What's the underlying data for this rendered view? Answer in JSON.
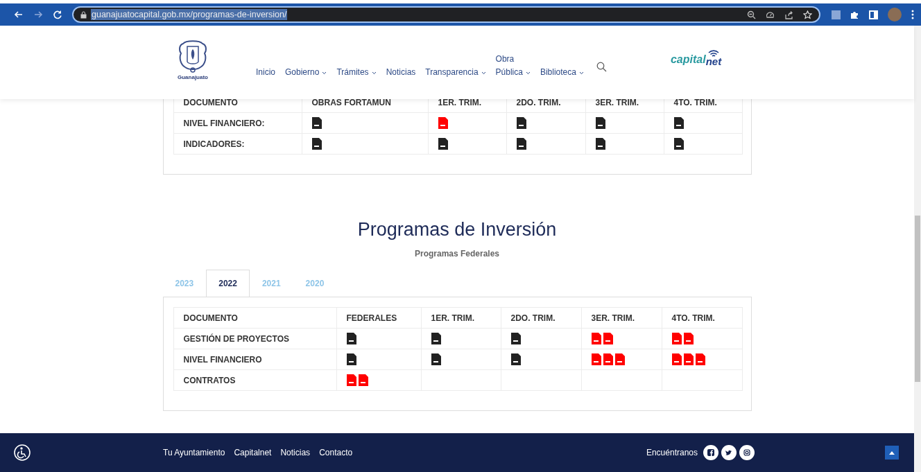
{
  "browser": {
    "url": "guanajuatocapital.gob.mx/programas-de-inversion/"
  },
  "header": {
    "logo_text": "Guanajuato",
    "nav": [
      {
        "label": "Inicio",
        "dropdown": false
      },
      {
        "label": "Gobierno",
        "dropdown": true
      },
      {
        "label": "Trámites",
        "dropdown": true
      },
      {
        "label": "Noticias",
        "dropdown": false
      },
      {
        "label": "Transparencia",
        "dropdown": true
      },
      {
        "label": "Obra Pública",
        "dropdown": true
      },
      {
        "label": "Biblioteca",
        "dropdown": true
      }
    ],
    "brand": {
      "part_1": "capital",
      "part_2": "net"
    }
  },
  "table_1": {
    "columns": [
      "DOCUMENTO",
      "OBRAS FORTAMUN",
      "1ER. TRIM.",
      "2DO. TRIM.",
      "3ER. TRIM.",
      "4TO. TRIM."
    ],
    "rows": [
      {
        "cells": [
          "NIVEL FINANCIERO:",
          [
            {
              "color": "#222222"
            }
          ],
          [
            {
              "color": "#ff0000"
            }
          ],
          [
            {
              "color": "#222222"
            }
          ],
          [
            {
              "color": "#222222"
            }
          ],
          [
            {
              "color": "#222222"
            }
          ]
        ]
      },
      {
        "cells": [
          "INDICADORES:",
          [
            {
              "color": "#222222"
            }
          ],
          [
            {
              "color": "#222222"
            }
          ],
          [
            {
              "color": "#222222"
            }
          ],
          [
            {
              "color": "#222222"
            }
          ],
          [
            {
              "color": "#222222"
            }
          ]
        ]
      }
    ]
  },
  "section": {
    "title": "Programas de Inversión",
    "subtitle": "Programas Federales",
    "tabs": [
      {
        "label": "2023",
        "selected": false
      },
      {
        "label": "2022",
        "selected": true
      },
      {
        "label": "2021",
        "selected": false
      },
      {
        "label": "2020",
        "selected": false
      }
    ]
  },
  "table_2": {
    "columns": [
      "DOCUMENTO",
      "FEDERALES",
      "1ER. TRIM.",
      "2DO. TRIM.",
      "3ER. TRIM.",
      "4TO. TRIM."
    ],
    "rows": [
      {
        "cells": [
          "GESTIÓN DE PROYECTOS",
          [
            {
              "color": "#222222"
            }
          ],
          [
            {
              "color": "#222222"
            }
          ],
          [
            {
              "color": "#222222"
            }
          ],
          [
            {
              "color": "#ff0000"
            },
            {
              "color": "#ff0000"
            }
          ],
          [
            {
              "color": "#ff0000"
            },
            {
              "color": "#ff0000"
            }
          ]
        ]
      },
      {
        "cells": [
          "NIVEL FINANCIERO",
          [
            {
              "color": "#222222"
            }
          ],
          [
            {
              "color": "#222222"
            }
          ],
          [
            {
              "color": "#222222"
            }
          ],
          [
            {
              "color": "#ff0000"
            },
            {
              "color": "#ff0000"
            },
            {
              "color": "#ff0000"
            }
          ],
          [
            {
              "color": "#ff0000"
            },
            {
              "color": "#ff0000"
            },
            {
              "color": "#ff0000"
            }
          ]
        ]
      },
      {
        "cells": [
          "CONTRATOS",
          [
            {
              "color": "#ff0000"
            },
            {
              "color": "#ff0000"
            }
          ],
          "",
          "",
          "",
          ""
        ]
      }
    ]
  },
  "footer": {
    "links": [
      "Tu Ayuntamiento",
      "Capitalnet",
      "Noticias",
      "Contacto"
    ],
    "social_label": "Encuéntranos"
  }
}
